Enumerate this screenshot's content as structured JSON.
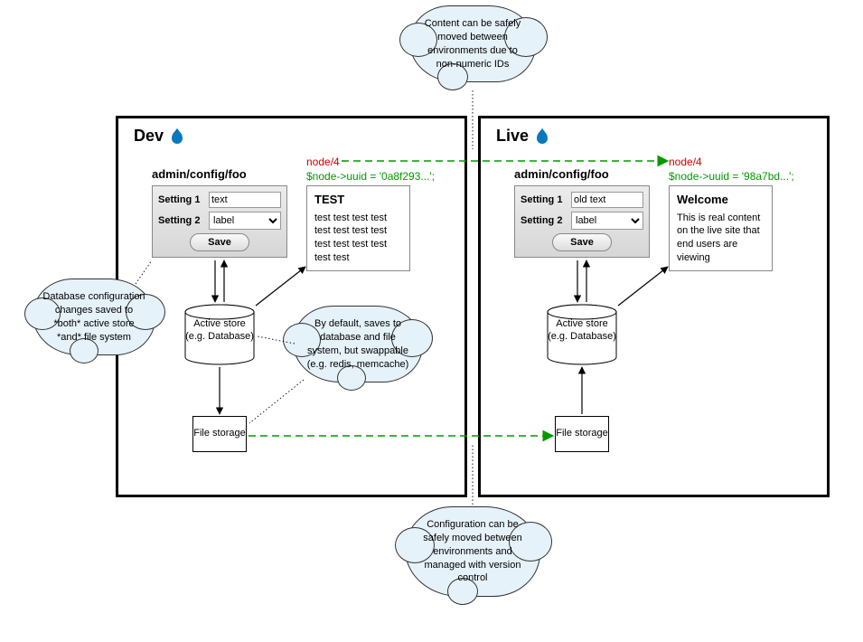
{
  "dev": {
    "title": "Dev",
    "configPath": "admin/config/foo",
    "nodePath": "node/4",
    "uuid": "$node->uuid = '0a8f293...';",
    "form": {
      "setting1Label": "Setting 1",
      "setting1Value": "text",
      "setting2Label": "Setting 2",
      "setting2Value": "label",
      "saveLabel": "Save"
    },
    "content": {
      "title": "TEST",
      "body": "test test test test test test test test test test test test test test"
    },
    "activeStore": "Active store (e.g. Database)",
    "fileStorage": "File storage"
  },
  "live": {
    "title": "Live",
    "configPath": "admin/config/foo",
    "nodePath": "node/4",
    "uuid": "$node->uuid = '98a7bd...';",
    "form": {
      "setting1Label": "Setting 1",
      "setting1Value": "old text",
      "setting2Label": "Setting 2",
      "setting2Value": "label",
      "saveLabel": "Save"
    },
    "content": {
      "title": "Welcome",
      "body": "This is real content on the live site that end users are viewing"
    },
    "activeStore": "Active store (e.g. Database)",
    "fileStorage": "File storage"
  },
  "clouds": {
    "top": "Content can be safely moved between environments due to non-numeric IDs",
    "left": "Database configuration changes saved to *both* active store *and* file system",
    "middle": "By default, saves to database and file system, but swappable (e.g. redis, memcache)",
    "bottom": "Configuration can be safely moved between environments and managed with version control"
  }
}
